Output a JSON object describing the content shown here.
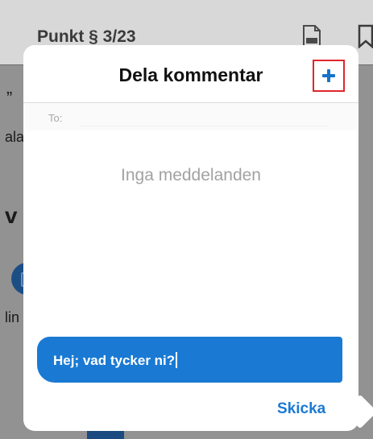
{
  "background": {
    "header_title": "Punkt § 3/23",
    "fragments": {
      "quote": "„",
      "ala": "ala",
      "v": "v",
      "lin": "lin"
    }
  },
  "popover": {
    "title": "Dela kommentar",
    "to_label": "To:",
    "empty_state": "Inga meddelanden",
    "message_text": "Hej; vad tycker ni?",
    "send_label": "Skicka"
  },
  "icons": {
    "add": "plus-icon",
    "pdf": "pdf-document-icon",
    "bookmark": "bookmark-icon"
  },
  "colors": {
    "accent": "#1a7ad3",
    "highlight_box": "#e0262b",
    "overlay": "#8e8e8e"
  }
}
